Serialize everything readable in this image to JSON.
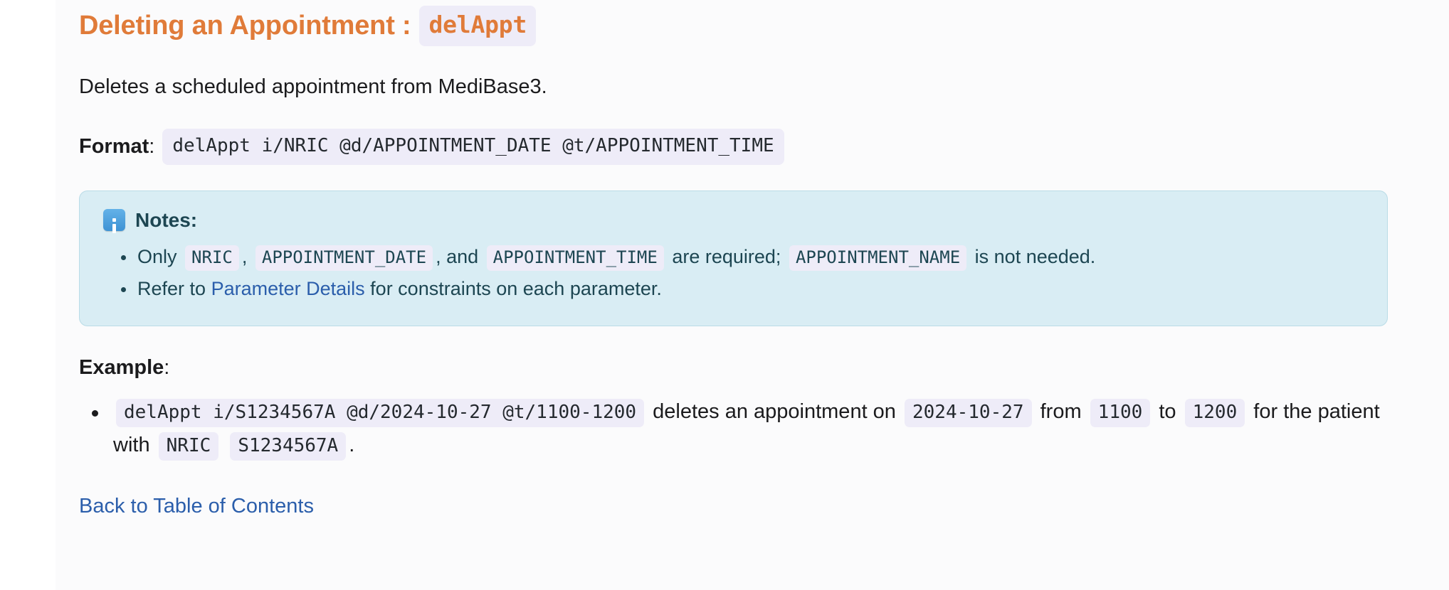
{
  "heading": {
    "title": "Deleting an Appointment :",
    "command": "delAppt"
  },
  "description": "Deletes a scheduled appointment from MediBase3.",
  "format": {
    "label": "Format",
    "colon": ":",
    "value": "delAppt i/NRIC @d/APPOINTMENT_DATE @t/APPOINTMENT_TIME"
  },
  "notes": {
    "icon": "info-icon",
    "title": "Notes:",
    "items": [
      {
        "prefix": "Only",
        "chip1": "NRIC",
        "sep1": ",",
        "chip2": "APPOINTMENT_DATE",
        "sep2": ", and",
        "chip3": "APPOINTMENT_TIME",
        "mid": "are required;",
        "chip4": "APPOINTMENT_NAME",
        "suffix": "is not needed."
      },
      {
        "prefix": "Refer to",
        "link": "Parameter Details",
        "suffix": "for constraints on each parameter."
      }
    ]
  },
  "example": {
    "label": "Example",
    "colon": ":",
    "item": {
      "command": "delAppt i/S1234567A @d/2024-10-27 @t/1100-1200",
      "text1": "deletes an appointment on",
      "date": "2024-10-27",
      "text2": "from",
      "start_time": "1100",
      "text3": "to",
      "end_time": "1200",
      "text4": "for the patient with",
      "nric_label": "NRIC",
      "nric_value": "S1234567A",
      "period": "."
    }
  },
  "footer": {
    "back_link": "Back to Table of Contents"
  },
  "colors": {
    "heading": "#e07b39",
    "link": "#2b5eab",
    "note_bg": "#d9edf4",
    "note_text": "#1d4652",
    "chip_bg": "#eeecf8",
    "body_text": "#1b1b1d",
    "page_bg": "#fbfbfc"
  }
}
